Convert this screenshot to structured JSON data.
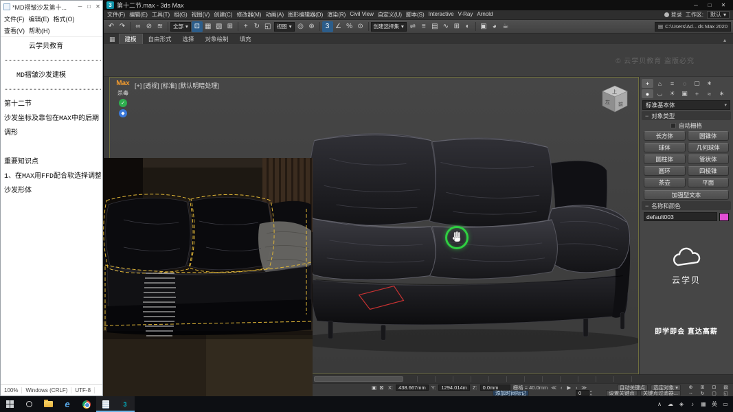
{
  "glyphs": {
    "dropdown": "▾",
    "collapse": "−",
    "check": "✓",
    "shield": "◆",
    "minimize": "─",
    "maximize": "□",
    "close": "✕",
    "spin_up": "▴",
    "spin_down": "▾",
    "folder": "▤",
    "chevron_up": "▴"
  },
  "notepad": {
    "title": "*MD褶皱沙发第十...",
    "menu": [
      "文件(F)",
      "编辑(E)",
      "格式(O)",
      "查看(V)",
      "帮助(H)"
    ],
    "lines": [
      "      云学贝教育",
      "----------------------------",
      "   MD褶皱沙发建模",
      "----------------------------",
      "第十二节",
      "沙发坐标及靠包在MAX中的后期",
      "调形",
      "",
      "重要知识点",
      "1、在MAX用FFD配合软选择调整",
      "沙发形体"
    ],
    "status": [
      "100%",
      "Windows (CRLF)",
      "UTF-8"
    ]
  },
  "max": {
    "title": "第十二节.max - 3ds Max",
    "app_glyph": "3",
    "menus": [
      "文件(F)",
      "编辑(E)",
      "工具(T)",
      "组(G)",
      "视图(V)",
      "创建(C)",
      "修改器(M)",
      "动画(A)",
      "图形编辑器(D)",
      "渲染(R)",
      "Civil View",
      "自定义(U)",
      "脚本(S)",
      "Interactive",
      "V-Ray",
      "Arnold"
    ],
    "login": "登录",
    "workspace_label": "工作区:",
    "workspace_value": "默认",
    "toolbar": {
      "group_history": [
        {
          "t": "↶",
          "name": "undo-icon"
        },
        {
          "t": "↷",
          "name": "redo-icon"
        }
      ],
      "group_link": [
        {
          "t": "∞",
          "name": "select-link-icon"
        },
        {
          "t": "⊘",
          "name": "unlink-icon"
        },
        {
          "t": "≋",
          "name": "bind-spacewarp-icon"
        }
      ],
      "filter_value": "全部",
      "group_select": [
        {
          "t": "⊡",
          "name": "select-object-icon",
          "active": true
        },
        {
          "t": "▦",
          "name": "select-by-name-icon"
        },
        {
          "t": "▧",
          "name": "selection-region-icon"
        },
        {
          "t": "⊞",
          "name": "window-crossing-icon"
        }
      ],
      "group_transform": [
        {
          "t": "+",
          "name": "select-move-icon"
        },
        {
          "t": "↻",
          "name": "select-rotate-icon"
        },
        {
          "t": "◱",
          "name": "select-scale-icon"
        }
      ],
      "coord_value": "视图",
      "group_pivot": [
        {
          "t": "◎",
          "name": "use-pivot-center-icon"
        },
        {
          "t": "⊛",
          "name": "select-manipulate-icon"
        }
      ],
      "group_snap": [
        {
          "t": "3",
          "name": "snaps-toggle-icon",
          "active": true
        },
        {
          "t": "∠",
          "name": "angle-snap-icon"
        },
        {
          "t": "%",
          "name": "percent-snap-icon"
        },
        {
          "t": "⊙",
          "name": "spinner-snap-icon"
        }
      ],
      "selset_value": "创建选择集",
      "group_manage": [
        {
          "t": "⇌",
          "name": "mirror-icon"
        },
        {
          "t": "≡",
          "name": "align-icon"
        },
        {
          "t": "▤",
          "name": "layer-manager-icon"
        },
        {
          "t": "∿",
          "name": "curve-editor-icon"
        },
        {
          "t": "⊞",
          "name": "schematic-view-icon"
        },
        {
          "t": "◐",
          "name": "material-editor-icon"
        }
      ],
      "group_render": [
        {
          "t": "▣",
          "name": "render-setup-icon"
        },
        {
          "t": "◕",
          "name": "rendered-frame-icon"
        },
        {
          "t": "☕",
          "name": "render-production-icon"
        }
      ],
      "project_path": "C:\\Users\\Ad…ds Max 2020"
    },
    "ribbon_tabs": [
      {
        "t": "建模",
        "name": "ribbon-tab-modeling",
        "active": true
      },
      {
        "t": "自由形式",
        "name": "ribbon-tab-freeform"
      },
      {
        "t": "选择",
        "name": "ribbon-tab-selection"
      },
      {
        "t": "对象绘制",
        "name": "ribbon-tab-object-paint"
      },
      {
        "t": "填充",
        "name": "ribbon-tab-populate"
      }
    ],
    "watermark": "© 云学贝教育 盗版必究",
    "viewport": {
      "label": "[+] [透视] [标准] [默认明暗处理]",
      "plugin_title": "Max",
      "plugin_sub": "杀毒",
      "viewcube": {
        "top": "上",
        "front": "前",
        "left": "左"
      }
    },
    "panel": {
      "tabs": [
        {
          "t": "+",
          "name": "create-tab-icon",
          "active": true
        },
        {
          "t": "⌂",
          "name": "modify-tab-icon"
        },
        {
          "t": "≡",
          "name": "hierarchy-tab-icon"
        },
        {
          "t": "◌",
          "name": "motion-tab-icon"
        },
        {
          "t": "▢",
          "name": "display-tab-icon"
        },
        {
          "t": "∗",
          "name": "utilities-tab-icon"
        }
      ],
      "categories": [
        {
          "t": "●",
          "name": "geometry-category-icon",
          "active": true
        },
        {
          "t": "◡",
          "name": "shapes-category-icon"
        },
        {
          "t": "☀",
          "name": "lights-category-icon"
        },
        {
          "t": "▣",
          "name": "cameras-category-icon"
        },
        {
          "t": "+",
          "name": "helpers-category-icon"
        },
        {
          "t": "≈",
          "name": "spacewarps-category-icon"
        },
        {
          "t": "∗",
          "name": "systems-category-icon"
        }
      ],
      "category_dropdown": "标准基本体",
      "rollout_object_type": "对象类型",
      "autogrid_label": "自动栅格",
      "object_buttons": [
        "长方体",
        "圆锥体",
        "球体",
        "几何球体",
        "圆柱体",
        "管状体",
        "圆环",
        "四棱锥",
        "茶壶",
        "平面"
      ],
      "text_button": "加强型文本",
      "rollout_name_color": "名称和颜色",
      "object_name": "default003",
      "swatch_color": "#e24fd4",
      "brand_name": "云学贝",
      "slogan": "即学即会 直达高薪"
    },
    "status": {
      "left_icons": [
        {
          "t": "▣",
          "name": "isolate-selection-toggle"
        },
        {
          "t": "⊠",
          "name": "selection-lock-toggle"
        }
      ],
      "x_label": "X:",
      "x_value": "438.667mm",
      "y_label": "Y:",
      "y_value": "1294.014m",
      "z_label": "Z:",
      "z_value": "0.0mm",
      "grid_label": "栅格 = 40.0mm",
      "transport": [
        {
          "t": "≪",
          "name": "go-to-start-button"
        },
        {
          "t": "‹",
          "name": "previous-frame-button"
        },
        {
          "t": "▶",
          "name": "play-button"
        },
        {
          "t": "›",
          "name": "next-frame-button"
        },
        {
          "t": "≫",
          "name": "go-to-end-button"
        }
      ],
      "frame_value": "0",
      "auto_key": "自动关键点",
      "selected_dd": "选定对象",
      "set_key": "设置关键点",
      "key_filters": "关键点过滤器...",
      "time_tag": "添加时间标记",
      "nav": [
        {
          "t": "⊕",
          "name": "zoom-icon"
        },
        {
          "t": "⊞",
          "name": "zoom-extents-all-icon"
        },
        {
          "t": "⊡",
          "name": "zoom-extents-icon"
        },
        {
          "t": "▧",
          "name": "zoom-region-icon"
        },
        {
          "t": "↔",
          "name": "pan-icon"
        },
        {
          "t": "↻",
          "name": "orbit-icon"
        },
        {
          "t": "▢",
          "name": "maximize-viewport-toggle-icon"
        },
        {
          "t": "◱",
          "name": "field-of-view-icon"
        }
      ]
    }
  },
  "taskbar": {
    "edge_glyph": "e",
    "max_glyph": "3",
    "tray": [
      {
        "t": "∧",
        "name": "tray-expand-icon"
      },
      {
        "t": "☁",
        "name": "cloud-sync-tray-icon"
      },
      {
        "t": "◈",
        "name": "antivirus-tray-icon"
      },
      {
        "t": "♪",
        "name": "volume-icon"
      },
      {
        "t": "▦",
        "name": "network-tray-icon"
      },
      {
        "t": "英",
        "name": "ime-language-indicator"
      },
      {
        "t": "▭",
        "name": "action-center-icon"
      }
    ]
  }
}
